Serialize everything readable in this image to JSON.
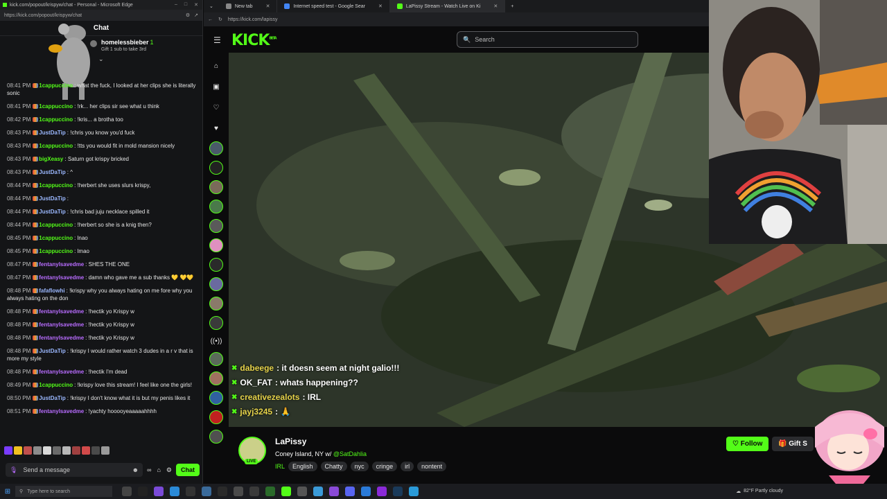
{
  "popout": {
    "window_title": "kick.com/popout/krispyw/chat - Personal - Microsoft Edge",
    "url": "https://kick.com/popout/krispyw/chat",
    "header": "Chat",
    "pinned_user": "homelessbieber",
    "pinned_count": "1",
    "pinned_sub": "Gift 1 sub to take 3rd",
    "send_placeholder": "Send a message",
    "chat_button": "Chat",
    "messages": [
      {
        "ts": "08:41 PM",
        "user": "1cappuccino",
        "color": "#53fc18",
        "text": "what the fuck, I looked at her clips she is literally sonic"
      },
      {
        "ts": "08:41 PM",
        "user": "1cappuccino",
        "color": "#53fc18",
        "text": "!rk... her clips sir see what u think"
      },
      {
        "ts": "08:42 PM",
        "user": "1cappuccino",
        "color": "#53fc18",
        "text": "!kris... a brotha too"
      },
      {
        "ts": "08:43 PM",
        "user": "JustDaTip",
        "color": "#9bb8ff",
        "text": "!chris you know you'd fuck"
      },
      {
        "ts": "08:43 PM",
        "user": "1cappuccino",
        "color": "#53fc18",
        "text": "!tts you would fit in mold mansion nicely"
      },
      {
        "ts": "08:43 PM",
        "user": "bigXeasy",
        "color": "#53fc18",
        "text": "Saturn got krispy bricked"
      },
      {
        "ts": "08:43 PM",
        "user": "JustDaTip",
        "color": "#9bb8ff",
        "text": "^"
      },
      {
        "ts": "08:44 PM",
        "user": "1cappuccino",
        "color": "#53fc18",
        "text": "!herbert she uses slurs krispy,"
      },
      {
        "ts": "08:44 PM",
        "user": "JustDaTip",
        "color": "#9bb8ff",
        "text": ""
      },
      {
        "ts": "08:44 PM",
        "user": "JustDaTip",
        "color": "#9bb8ff",
        "text": "!chris bad juju necklace spilled it"
      },
      {
        "ts": "08:44 PM",
        "user": "1cappuccino",
        "color": "#53fc18",
        "text": "!herbert so she is a knig then?"
      },
      {
        "ts": "08:45 PM",
        "user": "1cappuccino",
        "color": "#53fc18",
        "text": "lnao"
      },
      {
        "ts": "08:45 PM",
        "user": "1cappuccino",
        "color": "#53fc18",
        "text": "lmao"
      },
      {
        "ts": "08:47 PM",
        "user": "fentanylsavedme",
        "color": "#b86cff",
        "text": "SHES THE ONE"
      },
      {
        "ts": "08:47 PM",
        "user": "fentanylsavedme",
        "color": "#b86cff",
        "text": "damn who gave me a sub thanks 💛 💛💛"
      },
      {
        "ts": "08:48 PM",
        "user": "fafaflowhi",
        "color": "#9bb8ff",
        "text": "!krispy why you always hating on me fore why you always hating on the don"
      },
      {
        "ts": "08:48 PM",
        "user": "fentanylsavedme",
        "color": "#b86cff",
        "text": "!hectik yo Krispy w"
      },
      {
        "ts": "08:48 PM",
        "user": "fentanylsavedme",
        "color": "#b86cff",
        "text": "!hectik yo Krispy w"
      },
      {
        "ts": "08:48 PM",
        "user": "fentanylsavedme",
        "color": "#b86cff",
        "text": "!hectik yo Krispy w"
      },
      {
        "ts": "08:48 PM",
        "user": "JustDaTip",
        "color": "#9bb8ff",
        "text": "!krispy I would rather watch 3 dudes in a r v that is more my style"
      },
      {
        "ts": "08:48 PM",
        "user": "fentanylsavedme",
        "color": "#b86cff",
        "text": "!hectik I'm dead"
      },
      {
        "ts": "08:49 PM",
        "user": "1cappuccino",
        "color": "#53fc18",
        "text": "!krispy love this stream! I feel like one the girls!"
      },
      {
        "ts": "08:50 PM",
        "user": "JustDaTip",
        "color": "#9bb8ff",
        "text": "!krispy I don't know what it is but my penis likes it"
      },
      {
        "ts": "08:51 PM",
        "user": "fentanylsavedme",
        "color": "#b86cff",
        "text": "!yachty hooooyeaaaaahhhh"
      }
    ]
  },
  "browser": {
    "tabs": [
      {
        "label": "New tab",
        "active": false,
        "color": "#888888"
      },
      {
        "label": "Internet speed test - Google Sear",
        "active": false,
        "color": "#4285f4"
      },
      {
        "label": "LaPissy Stream - Watch Live on Ki",
        "active": true,
        "color": "#53fc18"
      }
    ],
    "new_tab": "+",
    "url": "https://kick.com/lapissy"
  },
  "kick": {
    "logo": "KICK",
    "logo_sup": "BETA",
    "search_placeholder": "Search"
  },
  "overlay_chat": [
    {
      "user": "dabeege",
      "color": "#e6d34a",
      "text": ": it doesn seem at night galio!!!"
    },
    {
      "user": "OK_FAT",
      "color": "#ffffff",
      "text": ": whats happening??"
    },
    {
      "user": "creativezealots",
      "color": "#e6d34a",
      "text": ": IRL"
    },
    {
      "user": "jayj3245",
      "color": "#e6d34a",
      "text": ": 🙏"
    }
  ],
  "channel": {
    "name": "LaPissy",
    "live": "LIVE",
    "title": "Coney Island, NY w/ ",
    "mention": "@SatDahlia",
    "category": "IRL",
    "tags": [
      "English",
      "Chatty",
      "nyc",
      "cringe",
      "irl",
      "nontent"
    ],
    "follow": "Follow",
    "gift": "Gift S"
  },
  "taskbar": {
    "search": "Type here to search",
    "weather": "82°F  Partly cloudy"
  },
  "colors": {
    "accent": "#53fc18"
  }
}
